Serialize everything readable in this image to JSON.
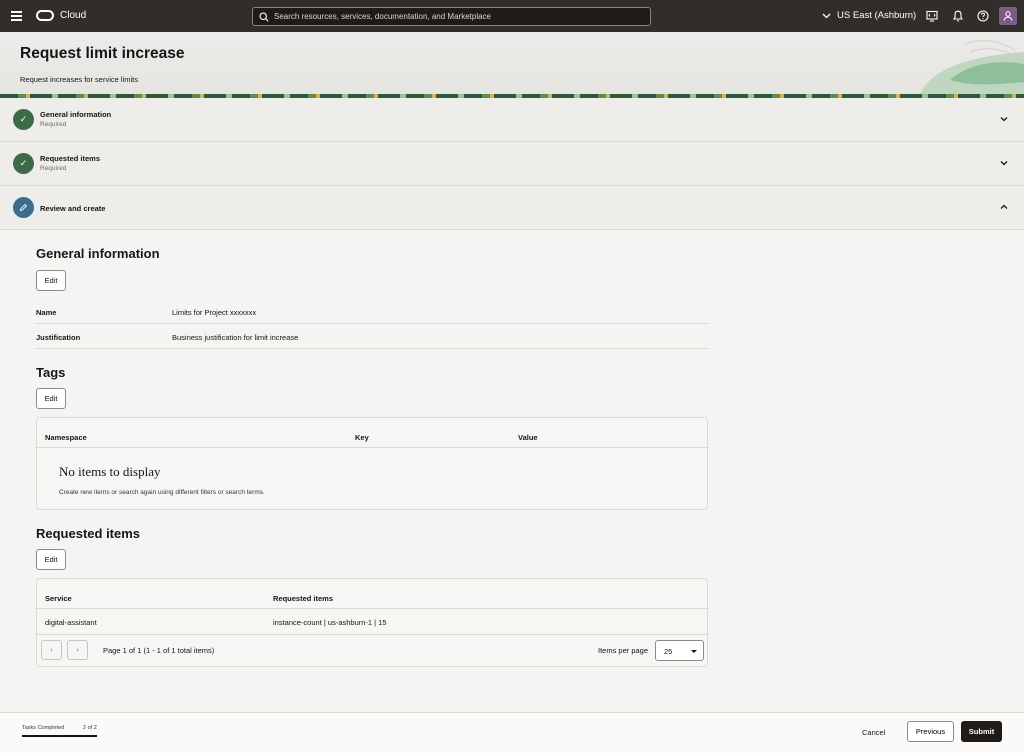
{
  "topbar": {
    "brand": "Cloud",
    "search_placeholder": "Search resources, services, documentation, and Marketplace",
    "region": "US East (Ashburn)",
    "icons": [
      "menu-icon",
      "oracle-logo",
      "search-icon",
      "chevron-down-icon",
      "code-editor-icon",
      "bell-icon",
      "help-icon",
      "user-icon"
    ]
  },
  "header": {
    "title": "Request limit increase",
    "subtitle": "Request increases for service limits"
  },
  "steps": [
    {
      "title": "General information",
      "status": "Required",
      "state": "complete"
    },
    {
      "title": "Requested items",
      "status": "Required",
      "state": "complete"
    },
    {
      "title": "Review and create",
      "state": "active"
    }
  ],
  "review": {
    "general": {
      "heading": "General information",
      "edit_label": "Edit",
      "fields": [
        {
          "label": "Name",
          "value": "Limits for Project xxxxxxx"
        },
        {
          "label": "Justification",
          "value": "Business justification for limit increase"
        }
      ]
    },
    "tags": {
      "heading": "Tags",
      "edit_label": "Edit",
      "columns": [
        "Namespace",
        "Key",
        "Value"
      ],
      "empty_title": "No items to display",
      "empty_subtitle": "Create new items or search again using different filters or search terms."
    },
    "requested": {
      "heading": "Requested items",
      "edit_label": "Edit",
      "columns": [
        "Service",
        "Requested items"
      ],
      "rows": [
        {
          "service": "digital-assistant",
          "items": "instance-count | us-ashburn-1 | 15"
        }
      ],
      "pagination_text": "Page 1 of 1 (1 - 1 of 1 total items)",
      "items_per_page_label": "Items per page",
      "items_per_page_value": "25"
    }
  },
  "footer": {
    "tasks_label": "Tasks Completed",
    "tasks_count": "2 of 2",
    "tasks_progress": 1.0,
    "cancel_label": "Cancel",
    "previous_label": "Previous",
    "submit_label": "Submit"
  },
  "colors": {
    "topbar_bg": "#312d2a",
    "step_complete": "#3d6b48",
    "step_active": "#3b6d8e",
    "submit_bg": "#1e1b19",
    "avatar": "#7d5b89"
  }
}
